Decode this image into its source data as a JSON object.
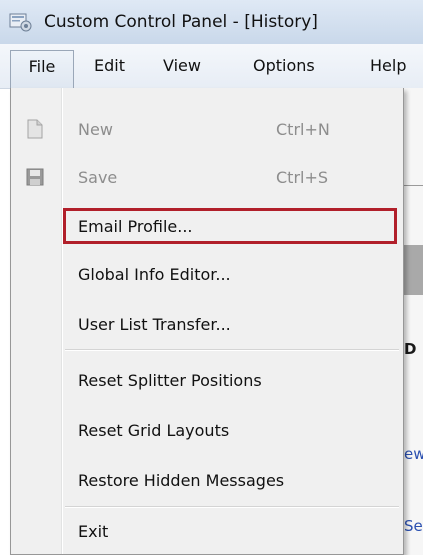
{
  "window": {
    "title": "Custom Control Panel - [History]",
    "app_icon": "control-panel-icon"
  },
  "menubar": {
    "items": [
      {
        "label": "File",
        "active": true
      },
      {
        "label": "Edit"
      },
      {
        "label": "View"
      },
      {
        "label": "Options"
      },
      {
        "label": "Help"
      }
    ]
  },
  "file_menu": {
    "items": [
      {
        "label": "New",
        "shortcut": "Ctrl+N",
        "enabled": false,
        "icon": "new-document-icon"
      },
      {
        "label": "Save",
        "shortcut": "Ctrl+S",
        "enabled": false,
        "icon": "save-disk-icon"
      },
      {
        "label": "Email Profile...",
        "highlighted": true
      },
      {
        "label": "Global Info Editor..."
      },
      {
        "label": "User List Transfer..."
      },
      {
        "label": "Reset Splitter Positions"
      },
      {
        "label": "Reset Grid Layouts"
      },
      {
        "label": "Restore Hidden Messages"
      },
      {
        "label": "Exit"
      }
    ]
  },
  "background_fragments": {
    "header_fragment": "D",
    "link_fragment_1": "ew",
    "link_fragment_2": "Se"
  },
  "colors": {
    "highlight_border": "#b11f2a",
    "menu_background": "#f0f0f0",
    "disabled_text": "#8d8d8d"
  }
}
